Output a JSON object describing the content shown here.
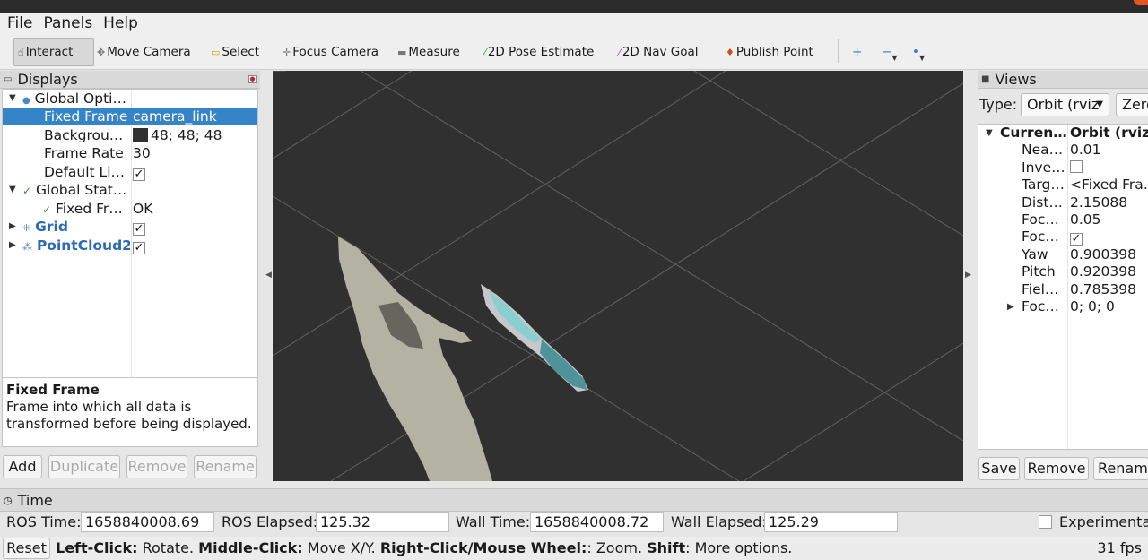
{
  "menu": {
    "file": "File",
    "panels": "Panels",
    "help": "Help"
  },
  "toolbar": {
    "interact": "Interact",
    "move_camera": "Move Camera",
    "select": "Select",
    "focus_camera": "Focus Camera",
    "measure": "Measure",
    "pose_estimate": "2D Pose Estimate",
    "nav_goal": "2D Nav Goal",
    "publish_point": "Publish Point"
  },
  "displays": {
    "title": "Displays",
    "rows": {
      "global_options": "Global Opti…",
      "fixed_frame_key": "Fixed Frame",
      "fixed_frame_value": "camera_link",
      "background_key": "Backgrou…",
      "background_value": "48; 48; 48",
      "frame_rate_key": "Frame Rate",
      "frame_rate_value": "30",
      "default_light_key": "Default Li…",
      "global_status": "Global Stat…",
      "fixed_frame_status_key": "Fixed Fr…",
      "fixed_frame_status_value": "OK",
      "grid": "Grid",
      "pointcloud": "PointCloud2"
    },
    "description": {
      "title": "Fixed Frame",
      "text": "Frame into which all data is transformed before being displayed."
    },
    "buttons": {
      "add": "Add",
      "duplicate": "Duplicate",
      "remove": "Remove",
      "rename": "Rename"
    }
  },
  "views": {
    "title": "Views",
    "type_label": "Type:",
    "type_value": "Orbit (rviz",
    "zero_button": "Zero",
    "rows": [
      {
        "key": "Curren…",
        "value": "Orbit (rviz)"
      },
      {
        "key": "Nea…",
        "value": "0.01"
      },
      {
        "key": "Inve…",
        "value": ""
      },
      {
        "key": "Targ…",
        "value": "<Fixed Fra…"
      },
      {
        "key": "Dist…",
        "value": "2.15088"
      },
      {
        "key": "Foc…",
        "value": "0.05"
      },
      {
        "key": "Foc…",
        "value": ""
      },
      {
        "key": "Yaw",
        "value": "0.900398"
      },
      {
        "key": "Pitch",
        "value": "0.920398"
      },
      {
        "key": "Fiel…",
        "value": "0.785398"
      },
      {
        "key": "Foc…",
        "value": "0; 0; 0"
      }
    ],
    "buttons": {
      "save": "Save",
      "remove": "Remove",
      "rename": "Rename"
    }
  },
  "time": {
    "title": "Time",
    "ros_time_label": "ROS Time:",
    "ros_time": "1658840008.69",
    "ros_elapsed_label": "ROS Elapsed:",
    "ros_elapsed": "125.32",
    "wall_time_label": "Wall Time:",
    "wall_time": "1658840008.72",
    "wall_elapsed_label": "Wall Elapsed:",
    "wall_elapsed": "125.29",
    "experimental": "Experimental"
  },
  "status": {
    "reset": "Reset",
    "left_click": "Left-Click:",
    "left_click_desc": " Rotate. ",
    "middle_click": "Middle-Click:",
    "middle_click_desc": " Move X/Y. ",
    "right_click": "Right-Click/Mouse Wheel:",
    "right_click_desc": ": Zoom. ",
    "shift": "Shift",
    "shift_desc": ": More options.",
    "fps": "31 fps"
  },
  "colors": {
    "viewport_background": "#303030",
    "selection": "#3584c8",
    "link_blue": "#2a6bb5"
  }
}
